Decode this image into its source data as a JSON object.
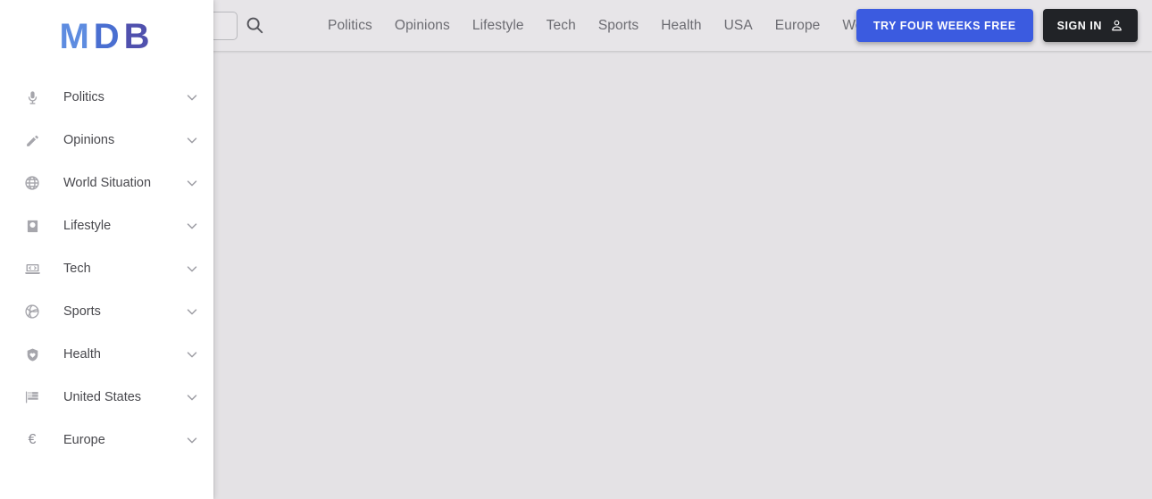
{
  "brand": {
    "letters": [
      "M",
      "D",
      "B"
    ],
    "colors": [
      "#5e8ce0",
      "#4a6fd1",
      "#5051ae"
    ]
  },
  "header": {
    "search": {
      "value": "",
      "placeholder": "",
      "icon": "search-icon"
    },
    "nav_links": [
      {
        "label": "Politics"
      },
      {
        "label": "Opinions"
      },
      {
        "label": "Lifestyle"
      },
      {
        "label": "Tech"
      },
      {
        "label": "Sports"
      },
      {
        "label": "Health"
      },
      {
        "label": "USA"
      },
      {
        "label": "Europe"
      },
      {
        "label": "World"
      }
    ],
    "trial_button": {
      "label": "TRY FOUR WEEKS FREE",
      "color": "#3b5be0"
    },
    "signin_button": {
      "label": "SIGN IN",
      "icon": "user-icon",
      "color": "#212327"
    }
  },
  "sidebar": {
    "items": [
      {
        "label": "Politics",
        "icon": "microphone-icon",
        "chevron": "chevron-down-icon"
      },
      {
        "label": "Opinions",
        "icon": "pencil-icon",
        "chevron": "chevron-down-icon"
      },
      {
        "label": "World Situation",
        "icon": "globe-icon",
        "chevron": "chevron-down-icon"
      },
      {
        "label": "Lifestyle",
        "icon": "passport-icon",
        "chevron": "chevron-down-icon"
      },
      {
        "label": "Tech",
        "icon": "laptop-code-icon",
        "chevron": "chevron-down-icon"
      },
      {
        "label": "Sports",
        "icon": "volleyball-icon",
        "chevron": "chevron-down-icon"
      },
      {
        "label": "Health",
        "icon": "shield-heart-icon",
        "chevron": "chevron-down-icon"
      },
      {
        "label": "United States",
        "icon": "flag-icon",
        "chevron": "chevron-down-icon"
      },
      {
        "label": "Europe",
        "icon": "euro-icon",
        "chevron": "chevron-down-icon"
      }
    ]
  },
  "main": {
    "background": "#e4e2e5",
    "content": ""
  }
}
